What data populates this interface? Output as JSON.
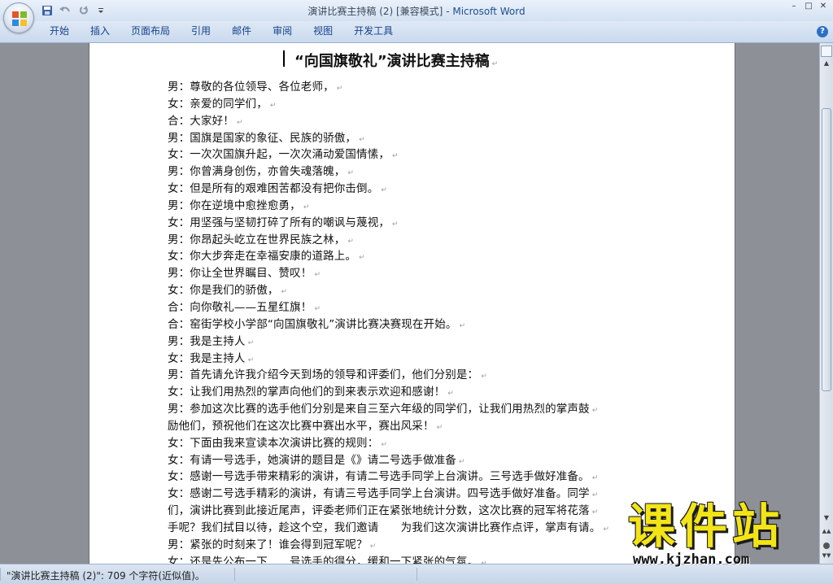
{
  "window": {
    "title_doc": "演讲比赛主持稿 (2) [兼容模式]",
    "title_sep": " - ",
    "title_app": "Microsoft Word",
    "controls": [
      "–",
      "□",
      "✕"
    ]
  },
  "ribbon": {
    "tabs": [
      "开始",
      "插入",
      "页面布局",
      "引用",
      "邮件",
      "审阅",
      "视图",
      "开发工具"
    ]
  },
  "document": {
    "title": "“向国旗敬礼”演讲比赛主持稿",
    "lines": [
      "男：尊敬的各位领导、各位老师，",
      "女：亲爱的同学们，",
      "合：大家好！",
      "男：国旗是国家的象征、民族的骄傲，",
      "女：一次次国旗升起，一次次涌动爱国情愫，",
      "男：你曾满身创伤，亦曾失魂落魄，",
      "女：但是所有的艰难困苦都没有把你击倒。",
      "男：你在逆境中愈挫愈勇，",
      "女：用坚强与坚韧打碎了所有的嘲讽与蔑视，",
      "男：你昂起头屹立在世界民族之林，",
      "女：你大步奔走在幸福安康的道路上。",
      "男：你让全世界瞩目、赞叹！",
      "女：你是我们的骄傲，",
      "合：向你敬礼——五星红旗！",
      "合：窑街学校小学部“向国旗敬礼”演讲比赛决赛现在开始。",
      "男：我是主持人",
      "女：我是主持人",
      "男：首先请允许我介绍今天到场的领导和评委们，他们分别是：",
      "女：让我们用热烈的掌声向他们的到来表示欢迎和感谢！",
      "男：参加这次比赛的选手他们分别是来自三至六年级的同学们，让我们用热烈的掌声鼓",
      "励他们，预祝他们在这次比赛中赛出水平，赛出风采！",
      "女：下面由我来宣读本次演讲比赛的规则：",
      "女：有请一号选手，她演讲的题目是《》请二号选手做准备",
      "女：感谢一号选手带来精彩的演讲，有请二号选手同学上台演讲。三号选手做好准备。",
      "女：感谢二号选手精彩的演讲，有请三号选手同学上台演讲。四号选手做好准备。同学",
      "们，演讲比赛到此接近尾声，评委老师们正在紧张地统计分数，这次比赛的冠军将花落",
      "手呢？我们拭目以待，趁这个空，我们邀请　　为我们这次演讲比赛作点评，掌声有请。",
      "男：紧张的时刻来了！谁会得到冠军呢？",
      "女：还是先公布一下……号选手的得分，缓和一下紧张的气氛。"
    ],
    "para_mark": "↵"
  },
  "status": {
    "text": "\"演讲比赛主持稿 (2)\": 709 个字符(近似值)。"
  },
  "watermark": {
    "logo": "课件站",
    "url": "www.kjzhan.com"
  },
  "icons": {
    "office": "office-button-icon",
    "save": "save-icon",
    "undo": "undo-icon",
    "redo": "redo-icon",
    "customize": "customize-qat-icon",
    "help": "help-icon"
  },
  "colors": {
    "title_app": "#1f4f8b",
    "tab_text": "#15428b",
    "watermark_yellow": "#f3e417"
  }
}
